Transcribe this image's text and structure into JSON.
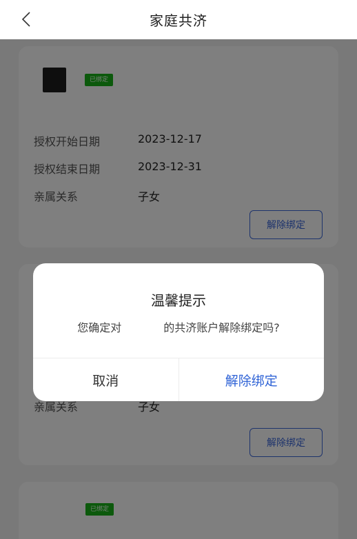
{
  "header": {
    "title": "家庭共济",
    "back_icon": "chevron-left-icon"
  },
  "cards": [
    {
      "badge": "已绑定",
      "rows": [
        {
          "label": "授权开始日期",
          "value": "2023-12-17"
        },
        {
          "label": "授权结束日期",
          "value": "2023-12-31"
        },
        {
          "label": "亲属关系",
          "value": "子女"
        }
      ],
      "unbind_label": "解除绑定"
    },
    {
      "rows": [
        {
          "label": "亲属关系",
          "value": "子女"
        }
      ],
      "unbind_label": "解除绑定"
    },
    {
      "badge": "已绑定"
    }
  ],
  "dialog": {
    "title": "温馨提示",
    "message": "您确定对            的共济账户解除绑定吗?",
    "cancel_label": "取消",
    "confirm_label": "解除绑定"
  },
  "colors": {
    "accent": "#2f63d6",
    "badge": "#18b318",
    "overlay": "rgba(0,0,0,0.5)"
  }
}
